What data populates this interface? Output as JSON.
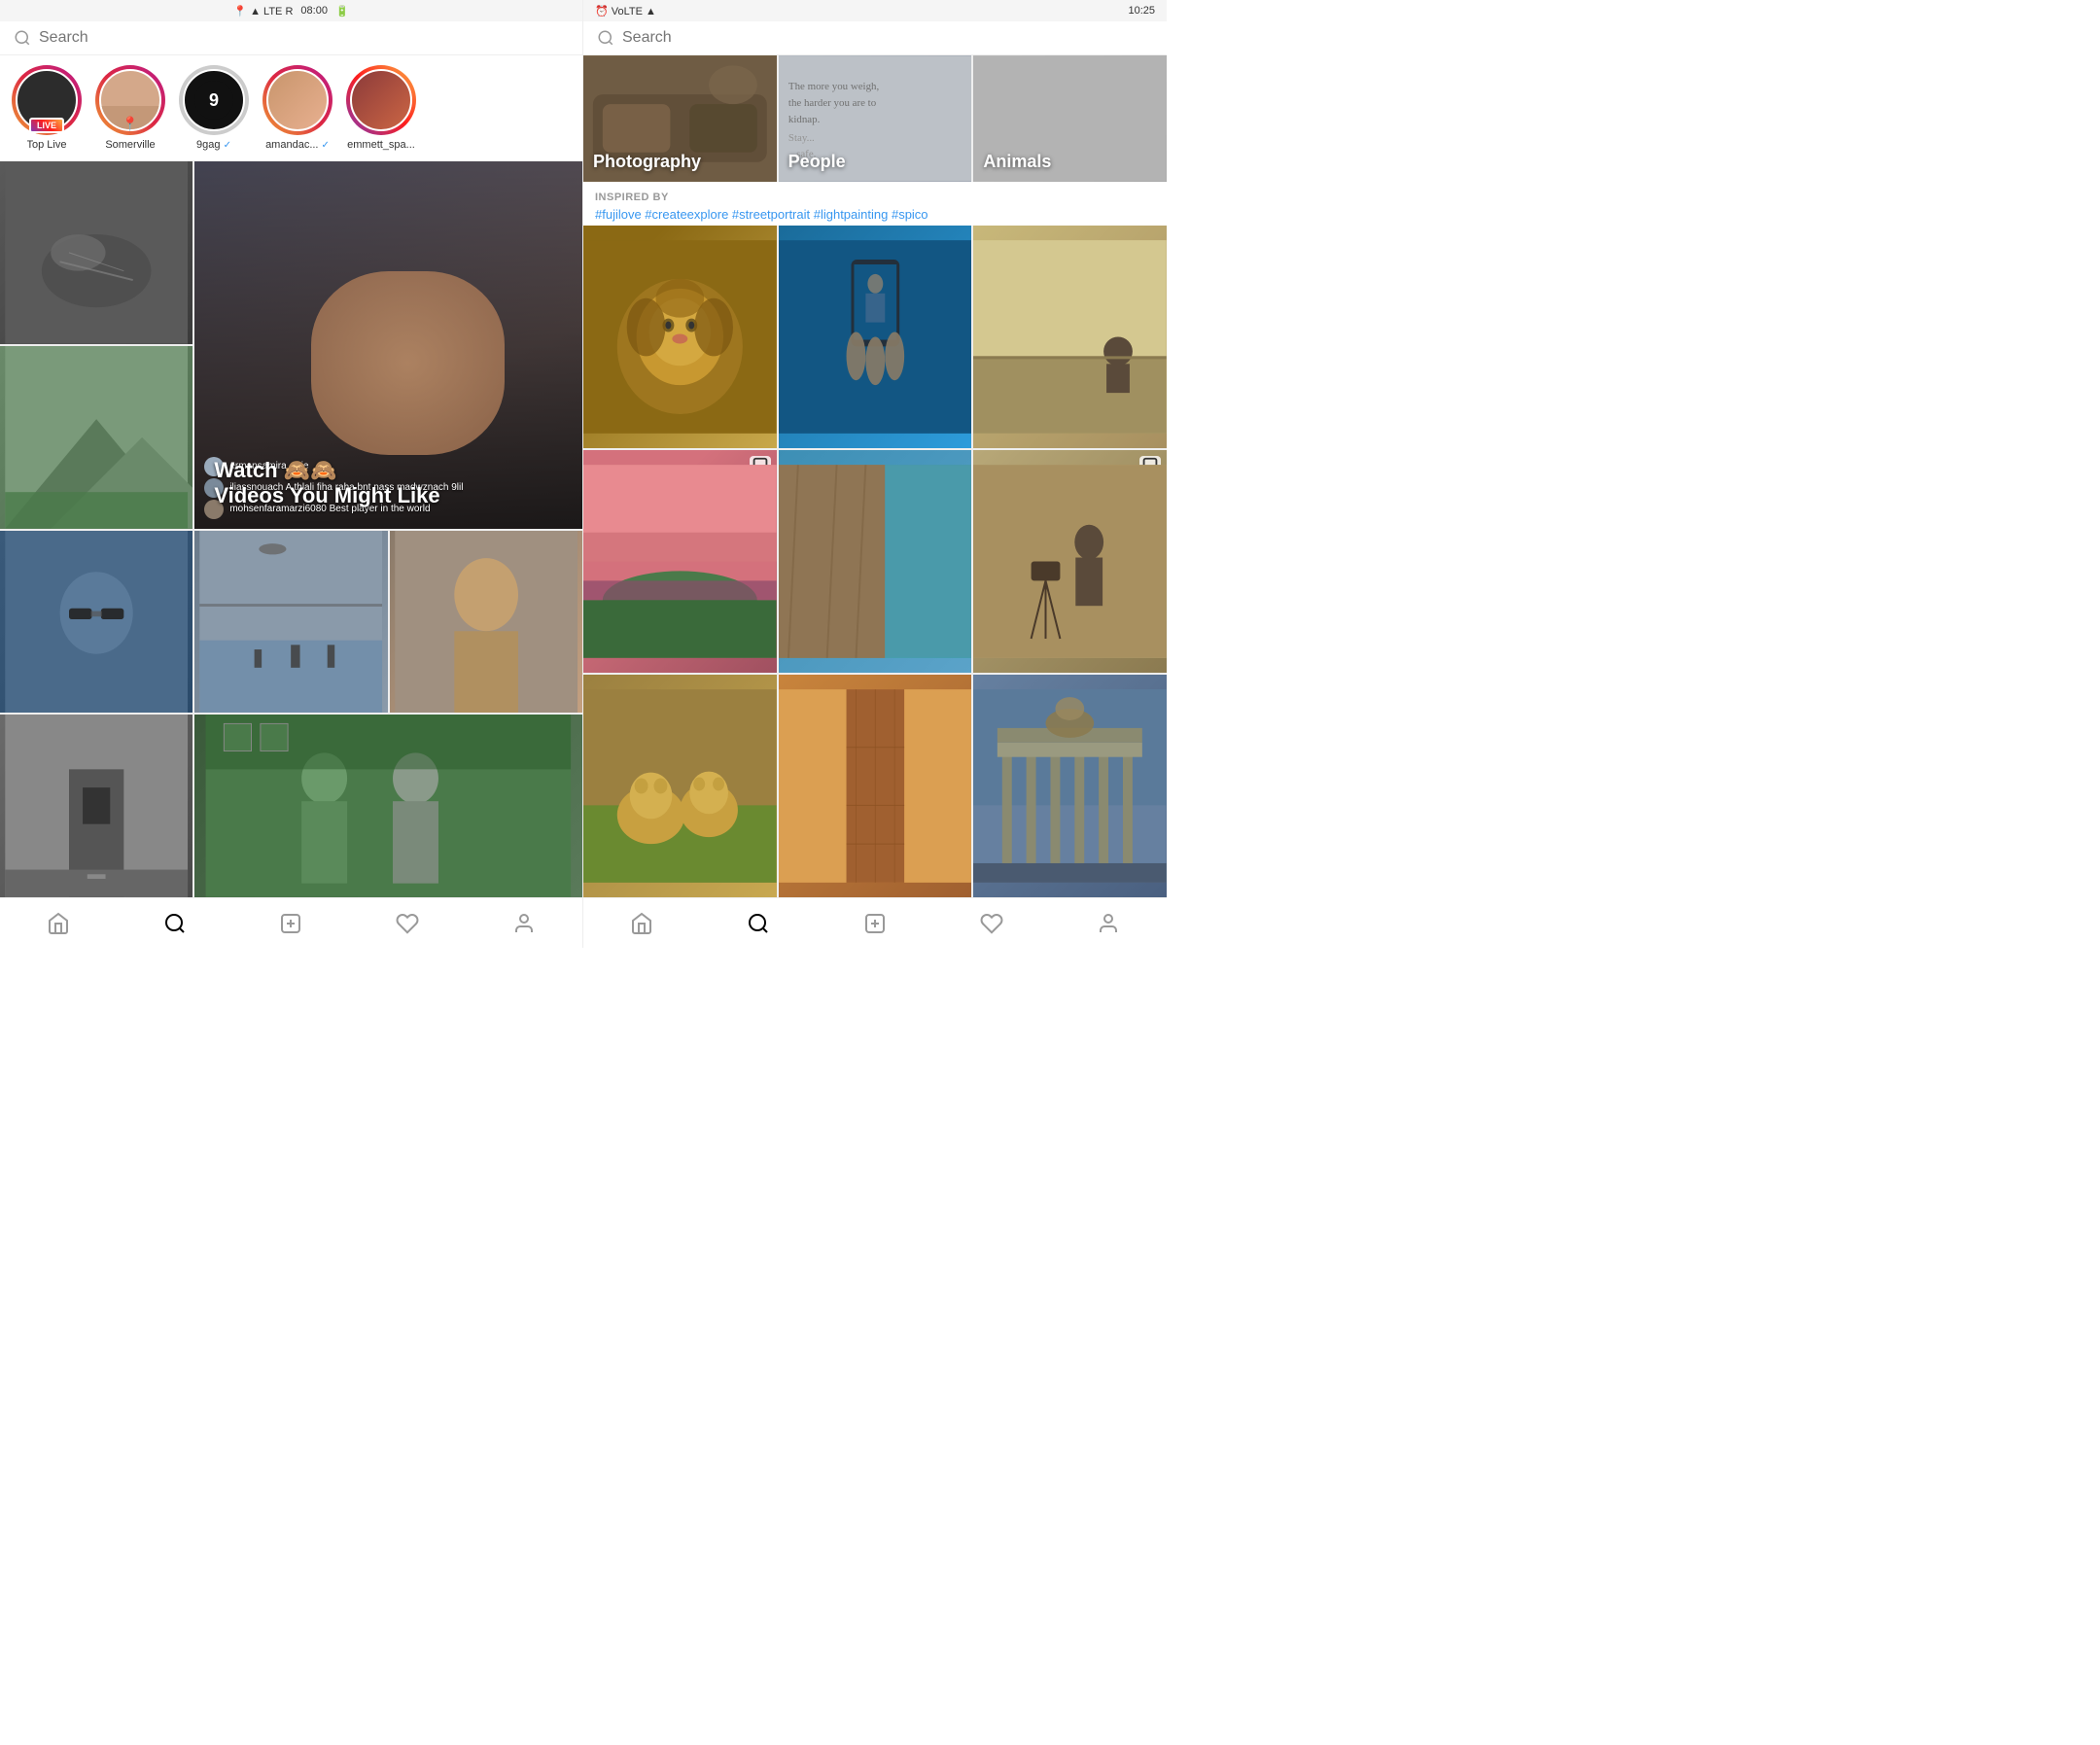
{
  "leftPanel": {
    "statusBar": {
      "time": "08:00",
      "icons": "📍 ▲ LTE R 🔋"
    },
    "searchPlaceholder": "Search",
    "stories": [
      {
        "id": "top-live",
        "label": "Top Live",
        "isLive": true,
        "avatarColor": "#2c2c2c",
        "ringType": "gradient-pink"
      },
      {
        "id": "somerville",
        "label": "Somerville",
        "hasPin": true,
        "avatarColor": "#d4a88a",
        "ringType": "gradient-pink"
      },
      {
        "id": "9gag",
        "label": "9gag",
        "verified": true,
        "is9gag": true,
        "ringType": "no-ring"
      },
      {
        "id": "amandac",
        "label": "amandac...",
        "verified": true,
        "avatarColor": "#c8956c",
        "ringType": "gradient-pink"
      },
      {
        "id": "emmett_spa",
        "label": "emmett_spa...",
        "avatarColor": "#8b3a3a",
        "ringType": "gradient-blue"
      }
    ],
    "gridCells": [
      {
        "id": "bird",
        "color": "#5a5a5a",
        "type": "image"
      },
      {
        "id": "live-video",
        "color": "#4a4a5a",
        "type": "live-span",
        "comments": [
          {
            "user": "ermansamira_",
            "text": "Pie"
          },
          {
            "user": "iliassnouach",
            "text": "A thlali fiha raha bnt nass madwznach 9lil"
          },
          {
            "user": "mohsenfaramarzi6080",
            "text": "Best player in the world"
          }
        ],
        "watchText": "Watch 🙈🙈\nVideos You Might Like"
      },
      {
        "id": "mountain",
        "color": "#6a8a6a",
        "type": "image"
      },
      {
        "id": "man-sunglasses",
        "color": "#3a5a7a",
        "type": "image"
      },
      {
        "id": "flood-street",
        "color": "#6a7a8a",
        "type": "image",
        "hasVideoIcon": true
      },
      {
        "id": "shirtless-man",
        "color": "#8a7a6a",
        "type": "image",
        "hasVideoIcon": true
      },
      {
        "id": "building-entrance",
        "color": "#7a7a7a",
        "type": "image"
      },
      {
        "id": "men-green",
        "color": "#4a6a4a",
        "type": "image-large"
      },
      {
        "id": "blonde-woman",
        "color": "#8a9a7a",
        "type": "image"
      },
      {
        "id": "sky-photo",
        "color": "#6a8aaa",
        "type": "image"
      },
      {
        "id": "dark-photo",
        "color": "#2a2a2a",
        "type": "image"
      }
    ],
    "bottomNav": [
      "home",
      "search",
      "add",
      "heart",
      "profile"
    ]
  },
  "rightPanel": {
    "statusBar": {
      "time": "10:25",
      "icons": "⏰ VoLTE ▲ 🔋"
    },
    "searchPlaceholder": "Search",
    "categories": [
      {
        "id": "photography",
        "label": "Photography",
        "tileClass": "tile-photography"
      },
      {
        "id": "people",
        "label": "People",
        "tileClass": "tile-people"
      },
      {
        "id": "animals",
        "label": "Animals",
        "tileClass": "tile-animals"
      }
    ],
    "inspiredBy": {
      "label": "INSPIRED BY",
      "hashtags": "#fujilove #createexplore #streetportrait #lightpainting #spico"
    },
    "photos": [
      {
        "id": "lion",
        "cssClass": "photo-lion",
        "row": 1,
        "col": 1
      },
      {
        "id": "phone-hand",
        "cssClass": "photo-phone",
        "row": 1,
        "col": 2
      },
      {
        "id": "person-landscape",
        "cssClass": "photo-person-bg",
        "row": 1,
        "col": 3
      },
      {
        "id": "coastal-landscape",
        "cssClass": "photo-landscape",
        "row": 2,
        "col": 1,
        "hasSave": true
      },
      {
        "id": "cliff-water",
        "cssClass": "photo-cliff",
        "row": 2,
        "col": 2
      },
      {
        "id": "woman-room",
        "cssClass": "photo-woman-room",
        "row": 2,
        "col": 3,
        "hasSave": true
      },
      {
        "id": "lion-cubs",
        "cssClass": "photo-cubs",
        "row": 3,
        "col": 1
      },
      {
        "id": "rock-formation",
        "cssClass": "photo-rock",
        "row": 3,
        "col": 2
      },
      {
        "id": "gate-building",
        "cssClass": "photo-gate",
        "row": 3,
        "col": 3
      }
    ],
    "bottomNav": [
      "home",
      "search",
      "add",
      "heart",
      "profile"
    ]
  }
}
